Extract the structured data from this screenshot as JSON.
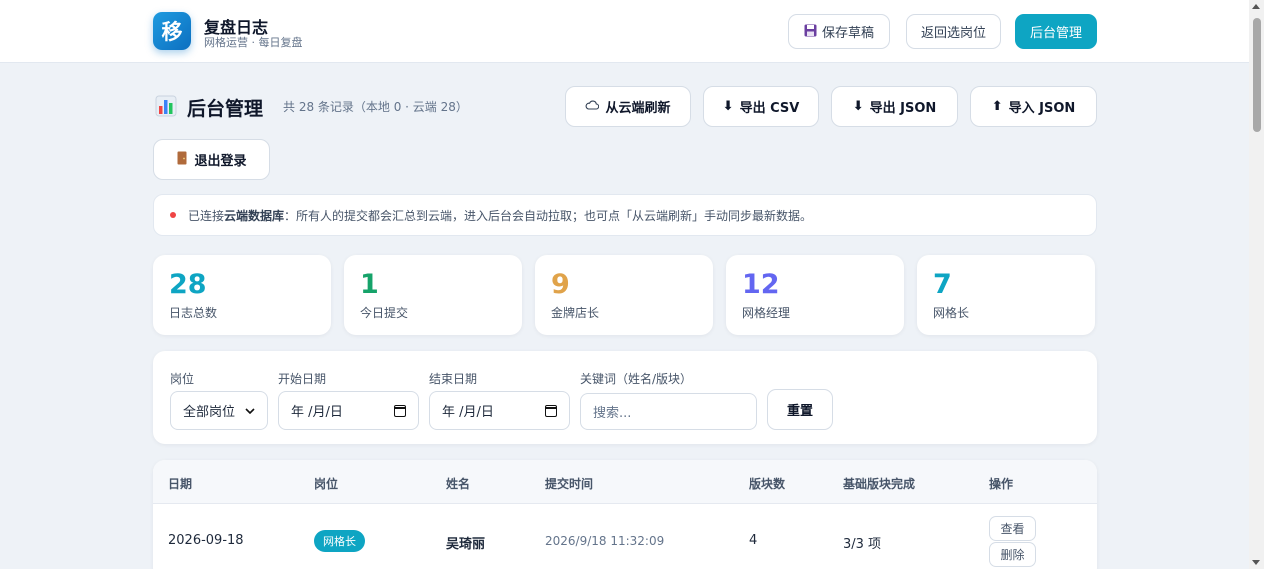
{
  "header": {
    "logo_char": "移",
    "title": "复盘日志",
    "subtitle": "网格运营 · 每日复盘",
    "save_draft_label": "保存草稿",
    "back_label": "返回选岗位",
    "admin_label": "后台管理"
  },
  "page": {
    "title": "后台管理",
    "meta": "共 28 条记录（本地 0 · 云端 28）",
    "actions": {
      "refresh_label": "从云端刷新",
      "export_csv_label": "导出 CSV",
      "export_json_label": "导出 JSON",
      "import_json_label": "导入 JSON",
      "logout_label": "退出登录"
    }
  },
  "notice": {
    "prefix": "已连接",
    "strong": "云端数据库",
    "text": "：所有人的提交都会汇总到云端，进入后台会自动拉取；也可点「从云端刷新」手动同步最新数据。"
  },
  "stats": [
    {
      "value": "28",
      "label": "日志总数",
      "color": "#0ea5c3"
    },
    {
      "value": "1",
      "label": "今日提交",
      "color": "#16a36a"
    },
    {
      "value": "9",
      "label": "金牌店长",
      "color": "#e0a34a"
    },
    {
      "value": "12",
      "label": "网格经理",
      "color": "#6366f1"
    },
    {
      "value": "7",
      "label": "网格长",
      "color": "#0ea5c3"
    }
  ],
  "filters": {
    "role_label": "岗位",
    "role_value": "全部岗位",
    "start_label": "开始日期",
    "start_value": "年 /月/日",
    "end_label": "结束日期",
    "end_value": "年 /月/日",
    "keyword_label": "关键词（姓名/版块）",
    "keyword_placeholder": "搜索...",
    "reset_label": "重置"
  },
  "table": {
    "headers": [
      "日期",
      "岗位",
      "姓名",
      "提交时间",
      "版块数",
      "基础版块完成",
      "操作"
    ],
    "rows": [
      {
        "date": "2026-09-18",
        "role": "网格长",
        "name": "吴琦丽",
        "time": "2026/9/18 11:32:09",
        "blocks": "4",
        "base_done": "3/3 项",
        "view_label": "查看",
        "delete_label": "删除"
      }
    ]
  }
}
